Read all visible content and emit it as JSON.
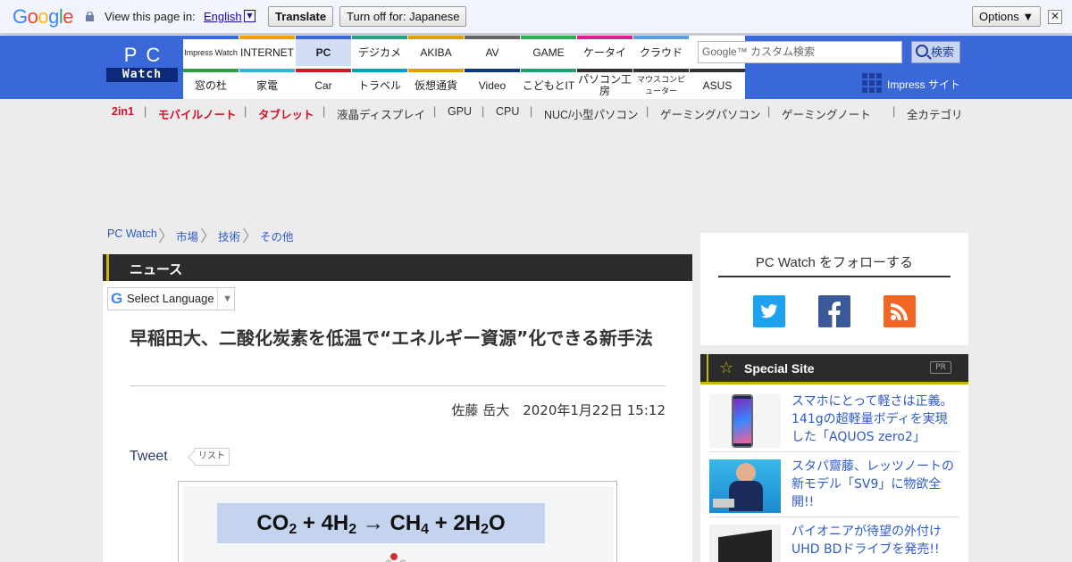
{
  "translate_bar": {
    "logo": "Google",
    "view_label": "View this page in:",
    "language": "English",
    "translate_button": "Translate",
    "turnoff_button": "Turn off for: Japanese",
    "options_button": "Options ▼",
    "close": "✕"
  },
  "header": {
    "logo_top": "PC",
    "logo_bottom": "Watch",
    "nav": [
      {
        "label": "Impress Watch",
        "color": "#3a68d8"
      },
      {
        "label": "INTERNET",
        "color": "#f0a000"
      },
      {
        "label": "PC",
        "color": "#3a68d8",
        "active": true
      },
      {
        "label": "デジカメ",
        "color": "#2aa080"
      },
      {
        "label": "AKIBA",
        "color": "#e0a000"
      },
      {
        "label": "AV",
        "color": "#666666"
      },
      {
        "label": "GAME",
        "color": "#2ab050"
      },
      {
        "label": "ケータイ",
        "color": "#e02090"
      },
      {
        "label": "クラウド",
        "color": "#5aa0e0"
      },
      {
        "label": "窓の杜",
        "color": "#2aa040"
      },
      {
        "label": "家電",
        "color": "#3ab0e0"
      },
      {
        "label": "Car",
        "color": "#c02020"
      },
      {
        "label": "トラベル",
        "color": "#00a0c0"
      },
      {
        "label": "仮想通貨",
        "color": "#e0a000"
      },
      {
        "label": "Video",
        "color": "#0c3a7a"
      },
      {
        "label": "こどもとIT",
        "color": "#20a070"
      },
      {
        "label": "パソコン工房",
        "color": "#333333"
      },
      {
        "label": "マウスコンピューター",
        "color": "#333333"
      },
      {
        "label": "ASUS",
        "color": "#333333"
      }
    ],
    "search_placeholder": "Google™ カスタム検索",
    "search_button": "検索",
    "impress_site": "Impress サイト"
  },
  "subnav": [
    {
      "label": "2in1",
      "red": true
    },
    {
      "label": "モバイルノート",
      "red": true
    },
    {
      "label": "タブレット",
      "red": true
    },
    {
      "label": "液晶ディスプレイ"
    },
    {
      "label": "GPU"
    },
    {
      "label": "CPU"
    },
    {
      "label": "NUC/小型パソコン"
    },
    {
      "label": "ゲーミングパソコン"
    },
    {
      "label": "ゲーミングノート"
    },
    {
      "label": "全カテゴリ"
    }
  ],
  "breadcrumb": [
    "PC Watch",
    "市場",
    "技術",
    "その他"
  ],
  "section": "ニュース",
  "select_language": "Select Language",
  "article": {
    "title": "早稲田大、二酸化炭素を低温で“エネルギー資源”化できる新手法",
    "author_date": "佐藤 岳大　2020年1月22日 15:12",
    "tweet": "Tweet",
    "list": "リスト",
    "formula_parts": [
      "CO",
      "2",
      " + 4H",
      "2",
      " → CH",
      "4",
      " + 2H",
      "2",
      "O"
    ]
  },
  "sidebar": {
    "follow_title": "PC Watch をフォローする",
    "social": [
      "twitter-icon",
      "facebook-icon",
      "rss-icon"
    ],
    "special_title": "Special Site",
    "pr": "PR",
    "items": [
      {
        "text": "スマホにとって軽さは正義。141gの超軽量ボディを実現した「AQUOS zero2」"
      },
      {
        "text": "スタパ齋藤、レッツノートの新モデル「SV9」に物欲全開!!"
      },
      {
        "text": "パイオニアが待望の外付けUHD BDドライブを発売!!"
      }
    ]
  },
  "colors": {
    "header_blue": "#3a68d8",
    "accent_yellow": "#c8b600",
    "link": "#2e5bc7",
    "red": "#d0102a"
  }
}
